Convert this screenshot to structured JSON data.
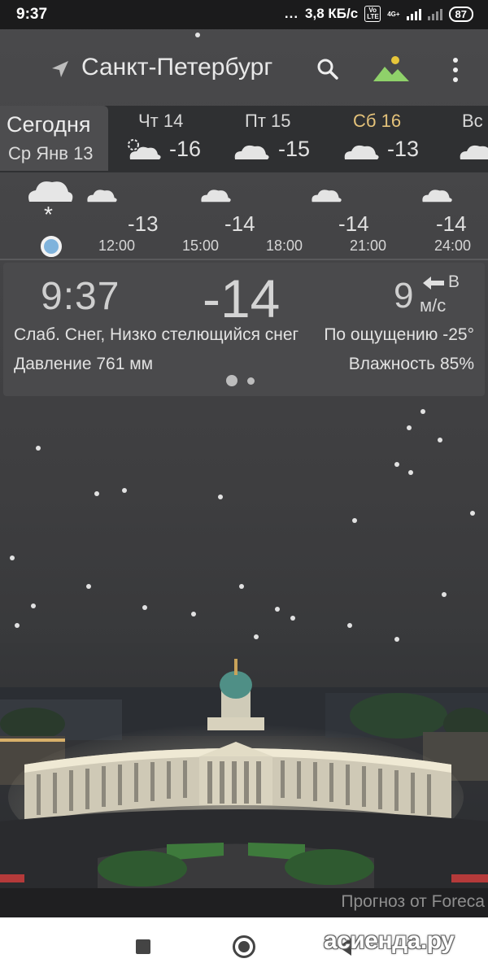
{
  "statusbar": {
    "time": "9:37",
    "dots": "...",
    "speed": "3,8 КБ/с",
    "network_badge": "Vo LTE",
    "signal_badge": "4G+",
    "battery": "87"
  },
  "toolbar": {
    "city": "Санкт-Петербург",
    "nav_icon": "location-arrow-icon",
    "search_icon": "search-icon",
    "scene_icon": "landscape-icon",
    "menu_icon": "more-vert-icon"
  },
  "days": {
    "today_label": "Сегодня",
    "today_date": "Ср Янв 13",
    "items": [
      {
        "name": "Чт 14",
        "temp": "-16",
        "icon": "partly-cloudy-icon"
      },
      {
        "name": "Пт 15",
        "temp": "-15",
        "icon": "cloud-icon"
      },
      {
        "name": "Сб 16",
        "temp": "-13",
        "icon": "cloud-icon"
      },
      {
        "name": "Вс",
        "temp": "",
        "icon": "cloud-icon"
      }
    ]
  },
  "hourly": {
    "now_symbol": "*",
    "items": [
      {
        "temp": "-13",
        "time": "12:00"
      },
      {
        "temp": "-14",
        "time": "15:00"
      },
      {
        "temp": "",
        "time": "18:00"
      },
      {
        "temp": "-14",
        "time": "21:00"
      },
      {
        "temp": "-14",
        "time": "24:00"
      }
    ]
  },
  "current": {
    "clock": "9:37",
    "temp": "-14",
    "wind_speed": "9",
    "wind_dir": "В",
    "wind_unit": "м/с",
    "condition": "Слаб. Снег, Низко стелющийся снег",
    "feels_like": "По ощущению -25°",
    "pressure": "Давление 761 мм",
    "humidity": "Влажность 85%"
  },
  "footer": {
    "credit": "Прогноз от Foreca",
    "watermark": "асиенда.ру"
  },
  "colors": {
    "accent_saturday": "#e4c27a",
    "now_dot": "#7fb3dc",
    "landscape_icon": "#8fd16a"
  }
}
